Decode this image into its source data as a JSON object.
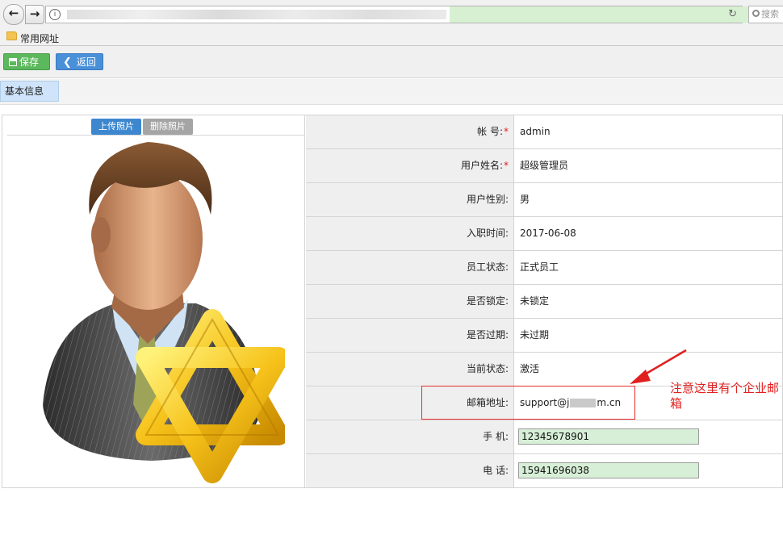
{
  "browser": {
    "search_placeholder": "搜索",
    "bookmark_label": "常用网址"
  },
  "toolbar": {
    "save_label": "保存",
    "back_label": "返回"
  },
  "tabs": [
    {
      "label": "基本信息"
    }
  ],
  "photo": {
    "upload_label": "上传照片",
    "delete_label": "删除照片"
  },
  "form": {
    "account": {
      "label": "帐 号:",
      "value": "admin",
      "required": true
    },
    "name": {
      "label": "用户姓名:",
      "value": "超级管理员",
      "required": true
    },
    "gender": {
      "label": "用户性别:",
      "value": "男"
    },
    "hire_date": {
      "label": "入职时间:",
      "value": "2017-06-08"
    },
    "employee_status": {
      "label": "员工状态:",
      "value": "正式员工"
    },
    "locked": {
      "label": "是否锁定:",
      "value": "未锁定"
    },
    "expired": {
      "label": "是否过期:",
      "value": "未过期"
    },
    "current_status": {
      "label": "当前状态:",
      "value": "激活"
    },
    "email": {
      "label": "邮箱地址:",
      "value_prefix": "support@j",
      "value_suffix": "m.cn"
    },
    "mobile": {
      "label": "手 机:",
      "value": "12345678901"
    },
    "phone": {
      "label": "电 话:",
      "value": "15941696038"
    }
  },
  "annotation": {
    "note": "注意这里有个企业邮箱",
    "color": "#e02020"
  },
  "colors": {
    "save_button": "#5cb85c",
    "back_button": "#4a90d9",
    "input_bg": "#d7efd7",
    "tab_bg": "#cfe4fa"
  }
}
